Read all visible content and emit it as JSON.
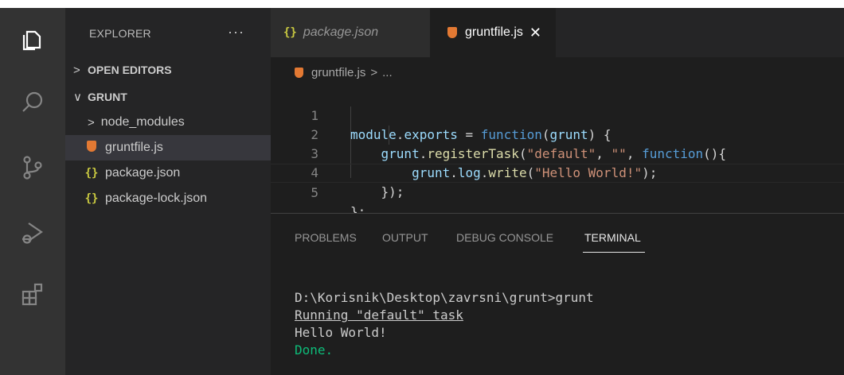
{
  "activity_bar": {
    "icons": [
      "explorer-icon",
      "search-icon",
      "source-control-icon",
      "run-debug-icon",
      "extensions-icon"
    ]
  },
  "sidebar": {
    "header": "EXPLORER",
    "more_actions": "···",
    "open_editors": "OPEN EDITORS",
    "folder": "GRUNT",
    "items": [
      {
        "label": "node_modules",
        "type": "folder"
      },
      {
        "label": "gruntfile.js",
        "type": "grunt-file",
        "selected": true
      },
      {
        "label": "package.json",
        "type": "json"
      },
      {
        "label": "package-lock.json",
        "type": "json"
      }
    ]
  },
  "tabs": [
    {
      "label": "package.json",
      "icon": "{}",
      "preview": true
    },
    {
      "label": "gruntfile.js",
      "active": true,
      "close": "✕"
    }
  ],
  "breadcrumb": {
    "file": "gruntfile.js",
    "separator": ">",
    "rest": "..."
  },
  "editor": {
    "line_numbers": [
      "1",
      "2",
      "3",
      "4",
      "5"
    ],
    "lines": [
      "module.exports = function(grunt) {",
      "    grunt.registerTask(\"default\", \"\", function(){",
      "        grunt.log.write(\"Hello World!\");",
      "    });",
      "};"
    ]
  },
  "panel": {
    "tabs": [
      "PROBLEMS",
      "OUTPUT",
      "DEBUG CONSOLE",
      "TERMINAL"
    ],
    "active_tab": "TERMINAL",
    "terminal_lines": [
      "D:\\Korisnik\\Desktop\\zavrsni\\grunt>grunt",
      "Running \"default\" task",
      "Hello World!",
      "Done."
    ]
  },
  "colors": {
    "activity_bar": "#333333",
    "sidebar": "#252526",
    "editor": "#1e1e1e",
    "keyword": "#569cd6",
    "string": "#ce9178",
    "function": "#dcdcaa",
    "terminal_success": "#0dbc79",
    "json_icon": "#cbcb41",
    "grunt_icon": "#e37933"
  }
}
